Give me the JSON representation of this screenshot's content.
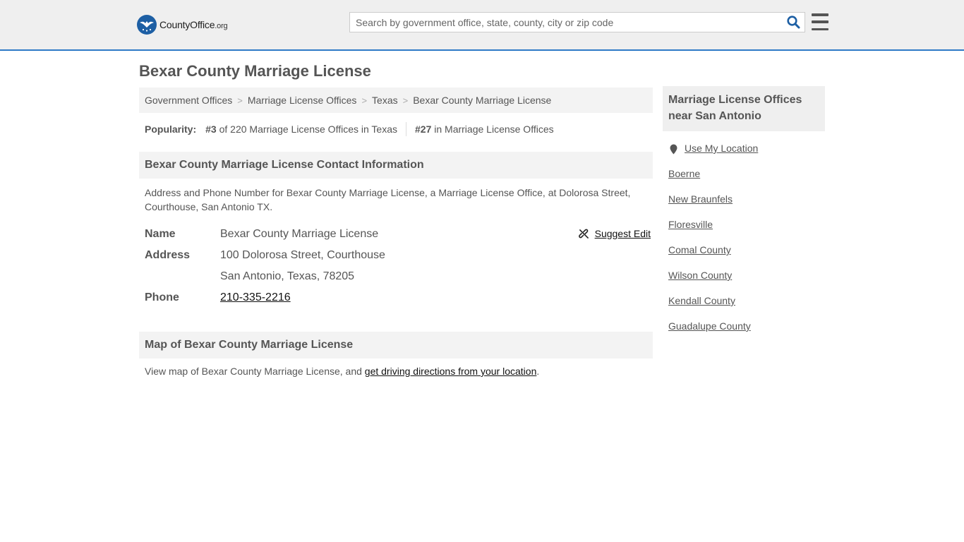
{
  "header": {
    "logo_name": "County",
    "logo_name_bold": "Office",
    "logo_tld": ".org",
    "search_placeholder": "Search by government office, state, county, city or zip code",
    "search_value": ""
  },
  "colors": {
    "accent": "#2f7ac6",
    "logo_blue": "#1d5fa4",
    "section_bg": "#f3f3f3",
    "text": "#555555"
  },
  "page": {
    "title": "Bexar County Marriage License"
  },
  "breadcrumb": [
    {
      "label": "Government Offices"
    },
    {
      "label": "Marriage License Offices"
    },
    {
      "label": "Texas"
    },
    {
      "label": "Bexar County Marriage License"
    }
  ],
  "popularity": {
    "label": "Popularity:",
    "state_rank": "#3",
    "state_text": "of 220 Marriage License Offices in Texas",
    "national_rank": "#27",
    "national_text": "in Marriage License Offices"
  },
  "contact": {
    "heading": "Bexar County Marriage License Contact Information",
    "description": "Address and Phone Number for Bexar County Marriage License, a Marriage License Office, at Dolorosa Street, Courthouse, San Antonio TX.",
    "suggest_edit": "Suggest Edit",
    "name_label": "Name",
    "name_value": "Bexar County Marriage License",
    "address_label": "Address",
    "address_line1": "100 Dolorosa Street, Courthouse",
    "address_line2": "San Antonio, Texas, 78205",
    "phone_label": "Phone",
    "phone_value": "210-335-2216"
  },
  "map": {
    "heading": "Map of Bexar County Marriage License",
    "text_before": "View map of Bexar County Marriage License, and ",
    "link": "get driving directions from your location",
    "text_after": "."
  },
  "sidebar": {
    "heading_line1": "Marriage License Offices",
    "heading_line2": "near San Antonio",
    "use_location": "Use My Location",
    "items": [
      {
        "label": "Boerne"
      },
      {
        "label": "New Braunfels"
      },
      {
        "label": "Floresville"
      },
      {
        "label": "Comal County"
      },
      {
        "label": "Wilson County"
      },
      {
        "label": "Kendall County"
      },
      {
        "label": "Guadalupe County"
      }
    ]
  }
}
